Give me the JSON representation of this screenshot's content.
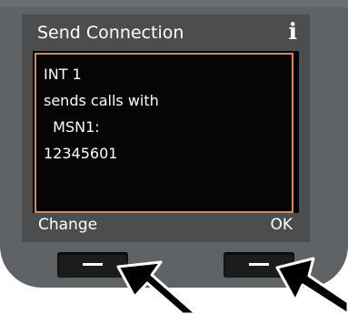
{
  "screen": {
    "title": "Send Connection",
    "info_glyph": "i",
    "lines": [
      "INT 1",
      "sends calls with",
      "  MSN1:",
      "12345601"
    ]
  },
  "softkeys": {
    "left_label": "Change",
    "right_label": "OK"
  },
  "icons": {
    "info": "info-icon",
    "left_key": "dash-icon",
    "right_key": "dash-icon",
    "left_arrow": "pointer-arrow-icon",
    "right_arrow": "pointer-arrow-icon"
  },
  "colors": {
    "device": "#5f6366",
    "screen_bg": "#4b4d4f",
    "content_bg": "#050505",
    "highlight_border": "#d1885a",
    "text": "#ffffff",
    "arrow": "#000000"
  }
}
